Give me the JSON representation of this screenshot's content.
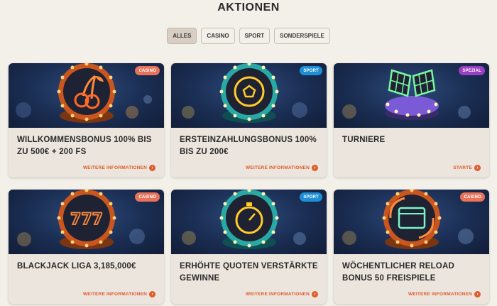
{
  "page": {
    "title": "AKTIONEN"
  },
  "filters": [
    {
      "label": "ALLES",
      "active": true
    },
    {
      "label": "CASINO",
      "active": false
    },
    {
      "label": "SPORT",
      "active": false
    },
    {
      "label": "SONDERSPIELE",
      "active": false
    }
  ],
  "colors": {
    "casino_badge": "#e8735a",
    "sport_badge": "#1e8fd6",
    "spezial_badge": "#9a3fc4",
    "link_accent": "#e05a2a"
  },
  "cards": [
    {
      "badge": "CASINO",
      "badge_type": "casino",
      "icon": "cherries-icon",
      "title": "WILLKOMMENSBONUS 100% BIS ZU 500€ + 200 FS",
      "link": "WEITERE INFORMATIONEN"
    },
    {
      "badge": "SPORT",
      "badge_type": "sport",
      "icon": "football-icon",
      "title": "ERSTEINZAHLUNGSBONUS 100% BIS ZU 200€",
      "link": "WEITERE INFORMATIONEN"
    },
    {
      "badge": "SPEZIAL",
      "badge_type": "spezial",
      "icon": "checkered-flags-icon",
      "title": "TURNIERE",
      "link": "STARTE"
    },
    {
      "badge": "CASINO",
      "badge_type": "casino",
      "icon": "triple-seven-icon",
      "title": "BLACKJACK LIGA 3,185,000€",
      "link": "WEITERE INFORMATIONEN"
    },
    {
      "badge": "SPORT",
      "badge_type": "sport",
      "icon": "stopwatch-icon",
      "title": "ERHÖHTE QUOTEN VERSTÄRKTE GEWINNE",
      "link": "WEITERE INFORMATIONEN"
    },
    {
      "badge": "CASINO",
      "badge_type": "casino",
      "icon": "calendar-reload-icon",
      "title": "WÖCHENTLICHER RELOAD BONUS 50 FREISPIELE",
      "link": "WEITERE INFORMATIONEN"
    }
  ]
}
